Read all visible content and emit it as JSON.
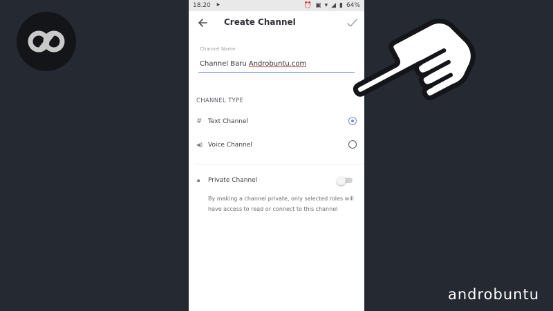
{
  "status_bar": {
    "time": "18.20",
    "battery": "64%"
  },
  "app_bar": {
    "title": "Create Channel"
  },
  "channel_name": {
    "label": "Channel Name",
    "value_prefix": "Channel Baru ",
    "value_underlined": "Androbuntu.com"
  },
  "channel_type": {
    "title": "CHANNEL TYPE",
    "options": [
      {
        "label": "Text Channel",
        "icon": "hash-icon",
        "selected": true
      },
      {
        "label": "Voice Channel",
        "icon": "speaker-icon",
        "selected": false
      }
    ]
  },
  "private_channel": {
    "label": "Private Channel",
    "enabled": false,
    "description": "By making a channel private, only selected roles will have access to read or connect to this channel"
  },
  "watermark": {
    "text": "androbuntu"
  },
  "colors": {
    "accent": "#7289da",
    "background": "#252932"
  }
}
